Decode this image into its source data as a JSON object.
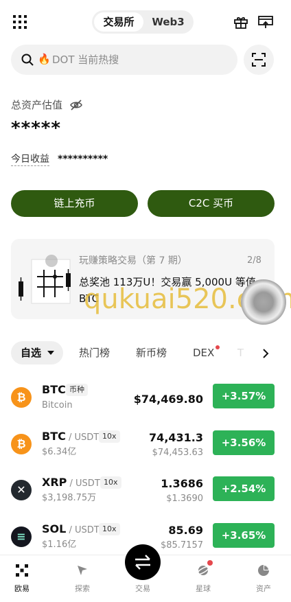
{
  "header": {
    "menu_icon": "grid-menu-icon",
    "segments": [
      "交易所",
      "Web3"
    ],
    "active_segment": "交易所",
    "gift_icon": "gift-icon",
    "notice_icon": "announcement-icon"
  },
  "search": {
    "placeholder": "DOT 当前热搜",
    "hot_icon": "🔥",
    "scan_icon": "scan-icon"
  },
  "assets": {
    "label": "总资产估值",
    "hidden_value": "*****",
    "today_profit_label": "今日收益",
    "today_profit_value": "**********"
  },
  "actions": {
    "deposit": "链上充币",
    "c2c": "C2C 买币"
  },
  "banner": {
    "title": "玩赚策略交易（第 7 期）",
    "page": "2/8",
    "text": "总奖池 113万U！交易赢 5,000U 等值 BTC"
  },
  "watermark": "qukuai520.com",
  "tabs": {
    "active": "自选",
    "items": [
      "热门榜",
      "新币榜",
      "DEX",
      "T"
    ]
  },
  "market": {
    "rows": [
      {
        "symbol": "BTC",
        "pair": "",
        "tag": "币种",
        "sub": "Bitcoin",
        "price": "$74,469.80",
        "price_sub": "",
        "change": "+3.57%",
        "icon_color": "#f7931a",
        "icon_glyph": "₿"
      },
      {
        "symbol": "BTC",
        "pair": " / USDT",
        "tag": "10x",
        "sub": "$6.34亿",
        "price": "74,431.3",
        "price_sub": "$74,453.63",
        "change": "+3.56%",
        "icon_color": "#f7931a",
        "icon_glyph": "₿"
      },
      {
        "symbol": "XRP",
        "pair": " / USDT",
        "tag": "10x",
        "sub": "$3,198.75万",
        "price": "1.3686",
        "price_sub": "$1.3690",
        "change": "+2.54%",
        "icon_color": "#23292f",
        "icon_glyph": "✕"
      },
      {
        "symbol": "SOL",
        "pair": " / USDT",
        "tag": "10x",
        "sub": "$1.16亿",
        "price": "85.69",
        "price_sub": "$85.7157",
        "change": "+3.65%",
        "icon_color": "#14161f",
        "icon_glyph": "≡"
      }
    ]
  },
  "bottom_nav": {
    "items": [
      "欧易",
      "探索",
      "交易",
      "星球",
      "资产"
    ],
    "active": "欧易"
  },
  "colors": {
    "brand_green": "#2f5a10",
    "up_green": "#2db257",
    "red_dot": "#e5484d"
  }
}
